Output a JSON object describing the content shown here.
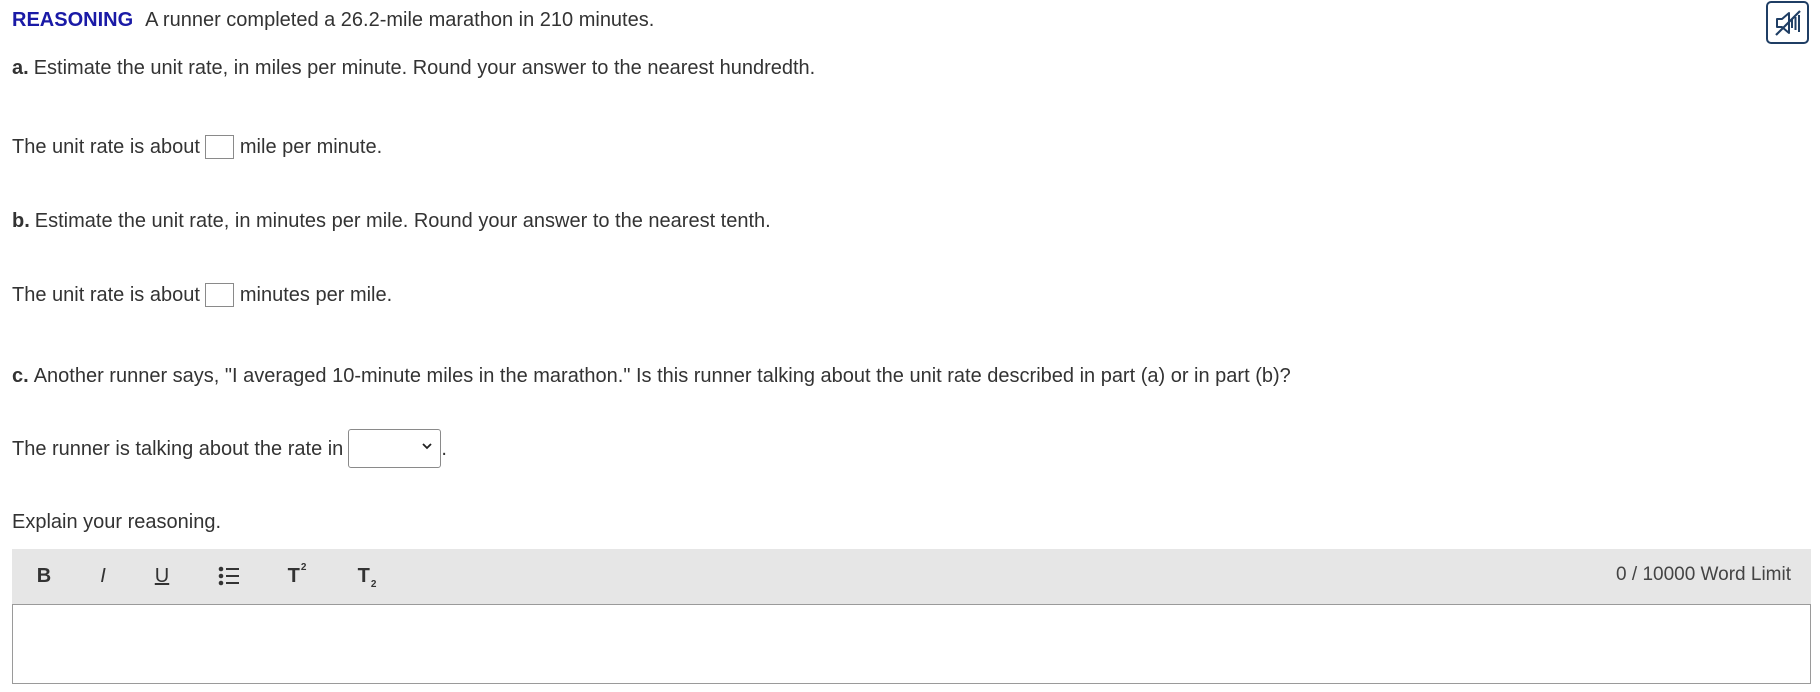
{
  "header": {
    "tag": "REASONING",
    "prompt": "A runner completed a 26.2-mile marathon in 210 minutes."
  },
  "audio_button": {
    "icon": "speaker-muted-icon"
  },
  "part_a": {
    "letter": "a.",
    "question": "Estimate the unit rate, in miles per minute. Round your answer to the nearest hundredth.",
    "answer_prefix": "The unit rate is about",
    "answer_value": "",
    "answer_suffix": "mile per minute."
  },
  "part_b": {
    "letter": "b.",
    "question": "Estimate the unit rate, in minutes per mile. Round your answer to the nearest tenth.",
    "answer_prefix": "The unit rate is about",
    "answer_value": "",
    "answer_suffix": "minutes per mile."
  },
  "part_c": {
    "letter": "c.",
    "question": "Another runner says, \"I averaged 10-minute miles in the marathon.\" Is this runner talking about the unit rate described in part (a) or in part (b)?",
    "answer_prefix": "The runner is talking about the rate in",
    "select_value": "",
    "answer_suffix": "."
  },
  "explain": {
    "label": "Explain your reasoning.",
    "toolbar": {
      "bold": "B",
      "italic": "I",
      "underline": "U",
      "superscript_base": "T",
      "superscript_mark": "2",
      "subscript_base": "T",
      "subscript_mark": "2",
      "word_count": "0",
      "separator": "/",
      "word_limit": "10000 Word Limit"
    },
    "editor_value": ""
  }
}
